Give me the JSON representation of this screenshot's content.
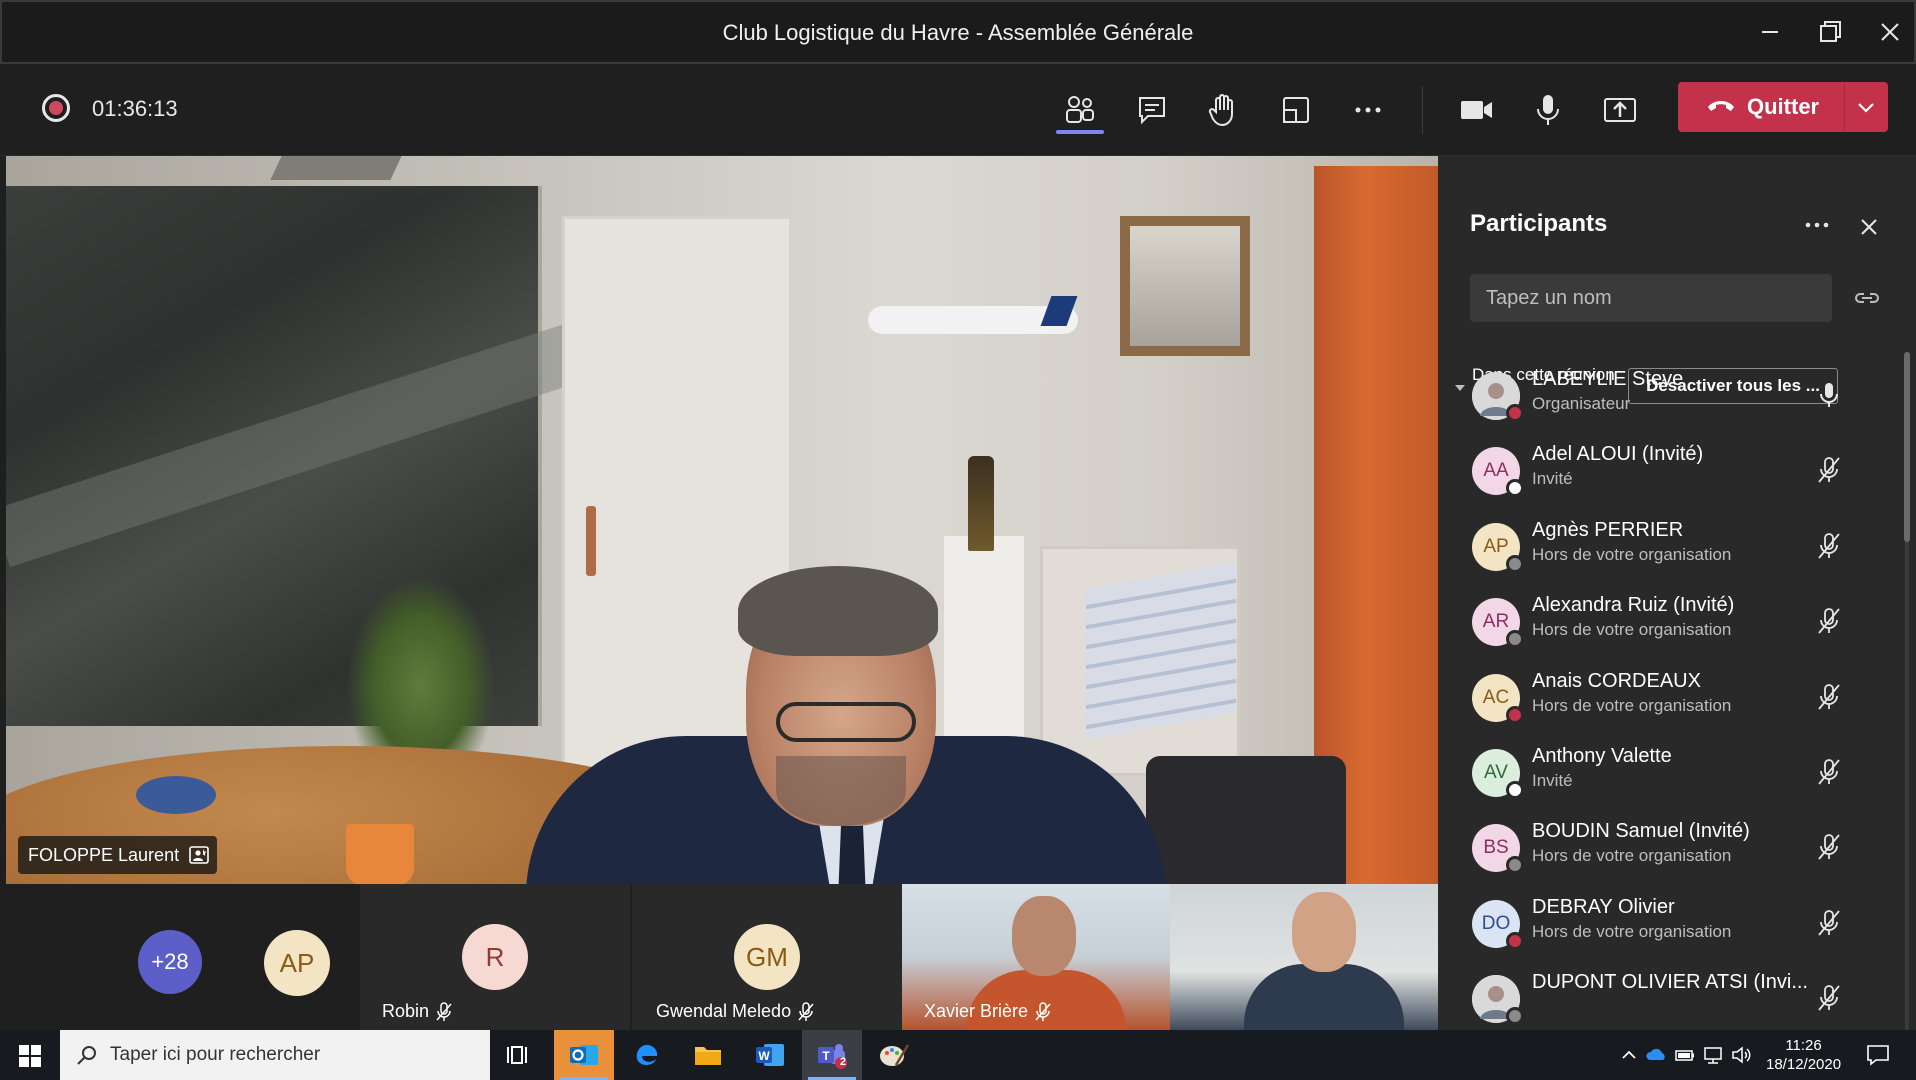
{
  "window": {
    "title": "Club Logistique du Havre - Assemblée Générale"
  },
  "toolbar": {
    "timer": "01:36:13",
    "quit_label": "Quitter"
  },
  "main_video": {
    "speaker_name": "FOLOPPE Laurent"
  },
  "gallery": {
    "overflow_count": "+28",
    "tiles": [
      {
        "initials": "AP",
        "name": "",
        "avatar_bg": "#f3e4c3",
        "avatar_fg": "#8a5b16"
      },
      {
        "initials": "R",
        "name": "Robin",
        "avatar_bg": "#f7d9d4",
        "avatar_fg": "#8f3b31"
      },
      {
        "initials": "GM",
        "name": "Gwendal Meledo",
        "avatar_bg": "#f3e4c3",
        "avatar_fg": "#8a5b16"
      },
      {
        "initials": "",
        "name": "Xavier Brière"
      }
    ]
  },
  "panel": {
    "title": "Participants",
    "search_placeholder": "Tapez un nom",
    "section_label": "Dans cette réunion (34)",
    "mute_all_label": "Désactiver tous les ...",
    "participants": [
      {
        "initials": "",
        "name": "LABEYLIE Steve",
        "role": "Organisateur",
        "avatar_bg": "#d9d9d9",
        "avatar_fg": "#444",
        "status": "#c4314b",
        "muted": false
      },
      {
        "initials": "AA",
        "name": "Adel ALOUI (Invité)",
        "role": "Invité",
        "avatar_bg": "#f2d7e6",
        "avatar_fg": "#8b2f5e",
        "status": "#ffffff",
        "muted": true
      },
      {
        "initials": "AP",
        "name": "Agnès PERRIER",
        "role": "Hors de votre organisation",
        "avatar_bg": "#f3e4c3",
        "avatar_fg": "#8a5b16",
        "status": "#8a8a8a",
        "muted": true
      },
      {
        "initials": "AR",
        "name": "Alexandra Ruiz (Invité)",
        "role": "Hors de votre organisation",
        "avatar_bg": "#f2d7e6",
        "avatar_fg": "#8b2f5e",
        "status": "#8a8a8a",
        "muted": true
      },
      {
        "initials": "AC",
        "name": "Anais CORDEAUX",
        "role": "Hors de votre organisation",
        "avatar_bg": "#f3e4c3",
        "avatar_fg": "#8a5b16",
        "status": "#c4314b",
        "muted": true
      },
      {
        "initials": "AV",
        "name": "Anthony Valette",
        "role": "Invité",
        "avatar_bg": "#dbeedd",
        "avatar_fg": "#2f6b36",
        "status": "#ffffff",
        "muted": true
      },
      {
        "initials": "BS",
        "name": "BOUDIN Samuel (Invité)",
        "role": "Hors de votre organisation",
        "avatar_bg": "#f2d7e6",
        "avatar_fg": "#8b2f5e",
        "status": "#8a8a8a",
        "muted": true
      },
      {
        "initials": "DO",
        "name": "DEBRAY Olivier",
        "role": "Hors de votre organisation",
        "avatar_bg": "#dbe4f3",
        "avatar_fg": "#2a4f8f",
        "status": "#c4314b",
        "muted": true
      },
      {
        "initials": "",
        "name": "DUPONT OLIVIER ATSI (Invi...",
        "role": "",
        "avatar_bg": "#f3e4c3",
        "avatar_fg": "#8a5b16",
        "status": "#8a8a8a",
        "muted": true
      }
    ]
  },
  "taskbar": {
    "search_placeholder": "Taper ici pour rechercher",
    "time": "11:26",
    "date": "18/12/2020",
    "teams_badge": "2"
  },
  "colors": {
    "accent": "#7f85f5",
    "danger": "#c4314b",
    "panel_bg": "#292929",
    "app_bg": "#1f1f1f"
  }
}
